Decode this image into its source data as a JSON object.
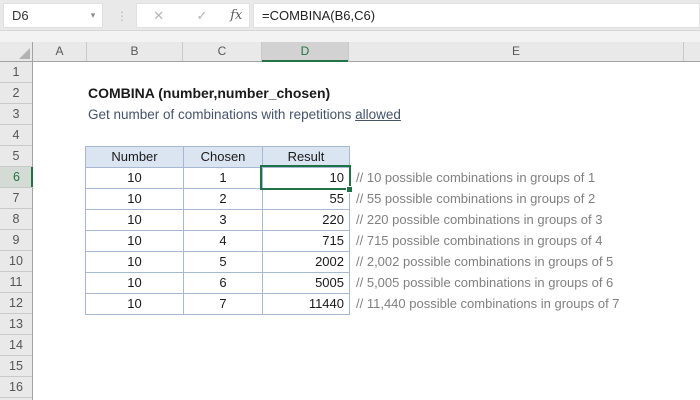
{
  "formula_bar": {
    "cell_reference": "D6",
    "formula": "=COMBINA(B6,C6)"
  },
  "icons": {
    "name_box_dropdown": "▾",
    "separator": "⋮",
    "cancel": "✕",
    "enter": "✓",
    "insert_function": "fx"
  },
  "grid": {
    "column_headers": [
      "A",
      "B",
      "C",
      "D",
      "E"
    ],
    "row_headers": [
      "1",
      "2",
      "3",
      "4",
      "5",
      "6",
      "7",
      "8",
      "9",
      "10",
      "11",
      "12",
      "13",
      "14",
      "15",
      "16"
    ],
    "selected_cell": "D6",
    "selected_column": "D",
    "selected_row": "6"
  },
  "sheet": {
    "title": "COMBINA (number,number_chosen)",
    "subtitle_text": "Get number of combinations with repetitions ",
    "subtitle_underlined": "allowed",
    "table": {
      "headers": [
        "Number",
        "Chosen",
        "Result"
      ],
      "rows": [
        {
          "number": "10",
          "chosen": "1",
          "result": "10",
          "comment": "// 10 possible combinations in groups of 1"
        },
        {
          "number": "10",
          "chosen": "2",
          "result": "55",
          "comment": "// 55 possible combinations in groups of 2"
        },
        {
          "number": "10",
          "chosen": "3",
          "result": "220",
          "comment": "// 220 possible combinations in groups of 3"
        },
        {
          "number": "10",
          "chosen": "4",
          "result": "715",
          "comment": "// 715 possible combinations in groups of 4"
        },
        {
          "number": "10",
          "chosen": "5",
          "result": "2002",
          "comment": "// 2,002 possible combinations in groups of 5"
        },
        {
          "number": "10",
          "chosen": "6",
          "result": "5005",
          "comment": "// 5,005 possible combinations in groups of 6"
        },
        {
          "number": "10",
          "chosen": "7",
          "result": "11440",
          "comment": "// 11,440 possible combinations in groups of 7"
        }
      ]
    }
  },
  "colors": {
    "accent_green": "#217346",
    "table_header_fill": "#dbe5f1",
    "table_border": "#a6b8d4",
    "comment_gray": "#808080",
    "subtitle_color": "#44546a",
    "chrome_gray": "#e9e9e9"
  }
}
